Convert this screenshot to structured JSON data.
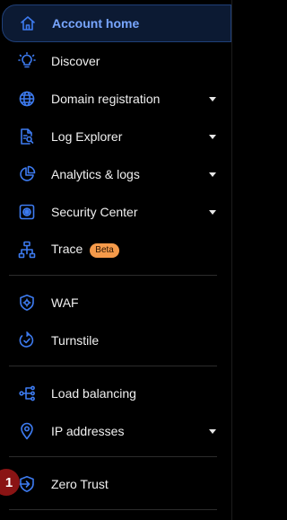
{
  "accent_color": "#3d7bf0",
  "active_bg_color": "#0c1a33",
  "badge_color": "#f59a4a",
  "step_marker": {
    "label": "1",
    "color": "#8a1414"
  },
  "nav": {
    "account_home": {
      "label": "Account home",
      "icon": "house-icon"
    },
    "discover": {
      "label": "Discover",
      "icon": "lightbulb-icon"
    },
    "domain_registration": {
      "label": "Domain registration",
      "icon": "globe-icon"
    },
    "log_explorer": {
      "label": "Log Explorer",
      "icon": "document-search-icon"
    },
    "analytics_logs": {
      "label": "Analytics & logs",
      "icon": "pie-chart-icon"
    },
    "security_center": {
      "label": "Security Center",
      "icon": "security-center-icon"
    },
    "trace": {
      "label": "Trace",
      "icon": "hierarchy-icon",
      "badge": "Beta"
    },
    "waf": {
      "label": "WAF",
      "icon": "shield-icon"
    },
    "turnstile": {
      "label": "Turnstile",
      "icon": "turnstile-icon"
    },
    "load_balancing": {
      "label": "Load balancing",
      "icon": "load-balancer-icon"
    },
    "ip_addresses": {
      "label": "IP addresses",
      "icon": "location-pin-icon"
    },
    "zero_trust": {
      "label": "Zero Trust",
      "icon": "shield-arrow-icon"
    }
  }
}
